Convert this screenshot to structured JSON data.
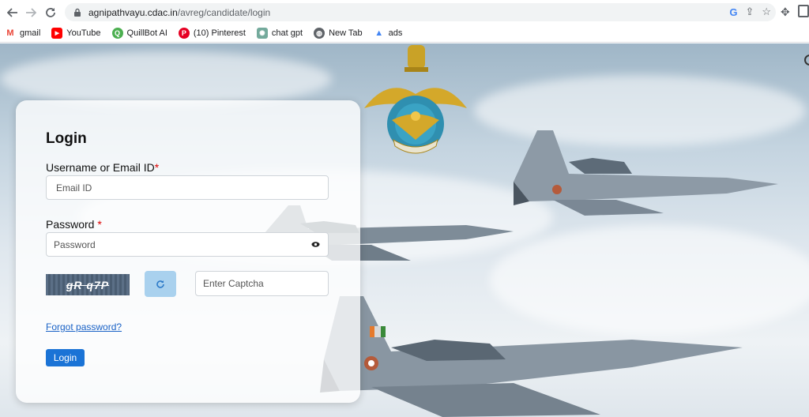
{
  "browser": {
    "url_host": "agnipathvayu.cdac.in",
    "url_path": "/avreg/candidate/login"
  },
  "bookmarks": [
    {
      "label": "gmail",
      "icon": "gmail-icon",
      "color": "#ea4335",
      "glyph": "M"
    },
    {
      "label": "YouTube",
      "icon": "youtube-icon",
      "color": "#ff0000",
      "glyph": "▶"
    },
    {
      "label": "QuillBot AI",
      "icon": "quillbot-icon",
      "color": "#4caf50",
      "glyph": "Q"
    },
    {
      "label": "(10) Pinterest",
      "icon": "pinterest-icon",
      "color": "#e60023",
      "glyph": "P"
    },
    {
      "label": "chat gpt",
      "icon": "chatgpt-icon",
      "color": "#74aa9c",
      "glyph": "✺"
    },
    {
      "label": "New Tab",
      "icon": "globe-icon",
      "color": "#5f6368",
      "glyph": "◍"
    },
    {
      "label": "ads",
      "icon": "google-ads-icon",
      "color": "#4285f4",
      "glyph": "▲"
    }
  ],
  "login": {
    "title": "Login",
    "username_label": "Username or Email ID",
    "username_placeholder": "Email ID",
    "password_label": "Password",
    "password_placeholder": "Password",
    "captcha_text": "gR q7P",
    "captcha_placeholder": "Enter Captcha",
    "forgot_label": "Forgot password?",
    "submit_label": "Login",
    "required_mark": "*"
  },
  "colors": {
    "primary": "#1a73d6",
    "link": "#1a62c6",
    "required": "#dd0000"
  }
}
